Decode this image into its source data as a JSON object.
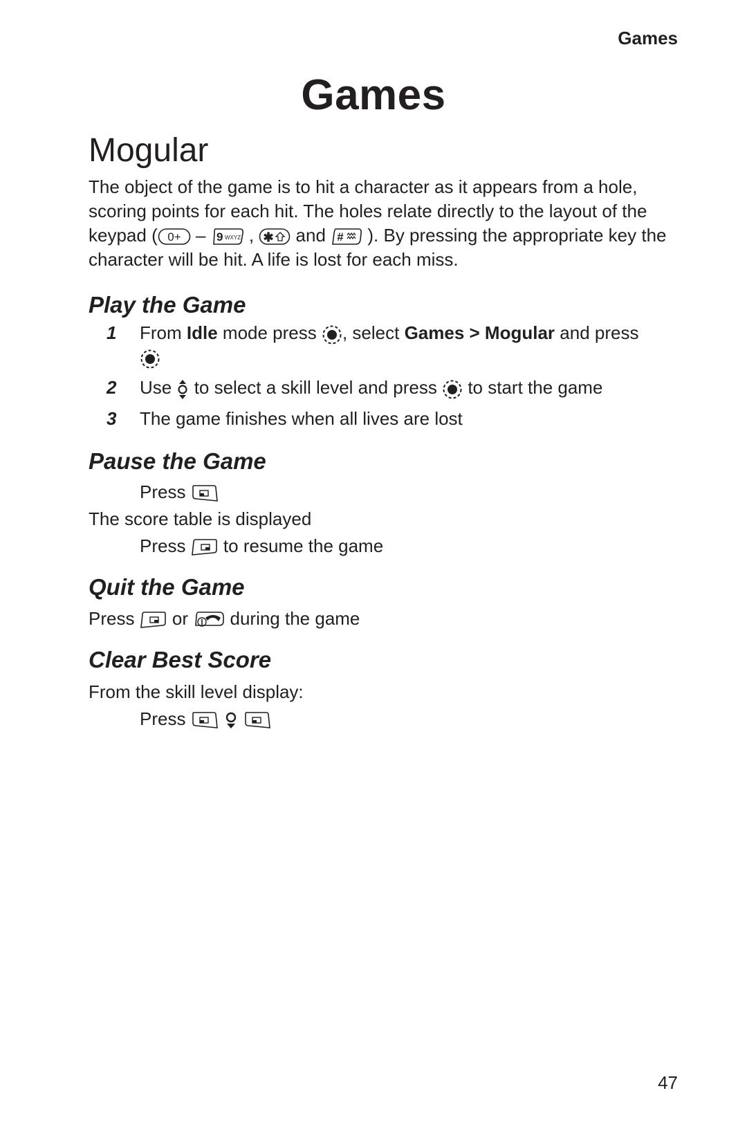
{
  "running_head": "Games",
  "page_title": "Games",
  "section": {
    "title": "Mogular",
    "intro": {
      "part1": "The object of the game is to hit a character as it appears from a hole, scoring points for each hit. The holes relate directly to the layout of the keypad (",
      "dash": " – ",
      "comma": " , ",
      "and": " and ",
      "part2": " ). By pressing the appropriate key the character will be hit. A life is lost for each miss."
    }
  },
  "play": {
    "heading": "Play the Game",
    "steps": [
      {
        "num": "1",
        "t1": "From ",
        "b1": "Idle",
        "t2": " mode press ",
        "t3": ", select ",
        "b2": "Games > Mogular",
        "t4": " and press"
      },
      {
        "num": "2",
        "t1": "Use ",
        "t2": " to select a skill level and press ",
        "t3": " to start the game"
      },
      {
        "num": "3",
        "t1": "The game finishes when all lives are lost"
      }
    ]
  },
  "pause": {
    "heading": "Pause the Game",
    "line1": "Press",
    "line2": "The score table is displayed",
    "line3a": "Press",
    "line3b": " to resume the game"
  },
  "quit": {
    "heading": "Quit the Game",
    "press": "Press ",
    "or": " or ",
    "during": " during the game"
  },
  "clear": {
    "heading": "Clear Best Score",
    "line1": "From the skill level display:",
    "press": "Press"
  },
  "icons": {
    "key0": "0+",
    "key9_num": "9",
    "key9_letters": "WXYZ",
    "key_star": "✱",
    "key_hash": "#"
  },
  "page_number": "47"
}
